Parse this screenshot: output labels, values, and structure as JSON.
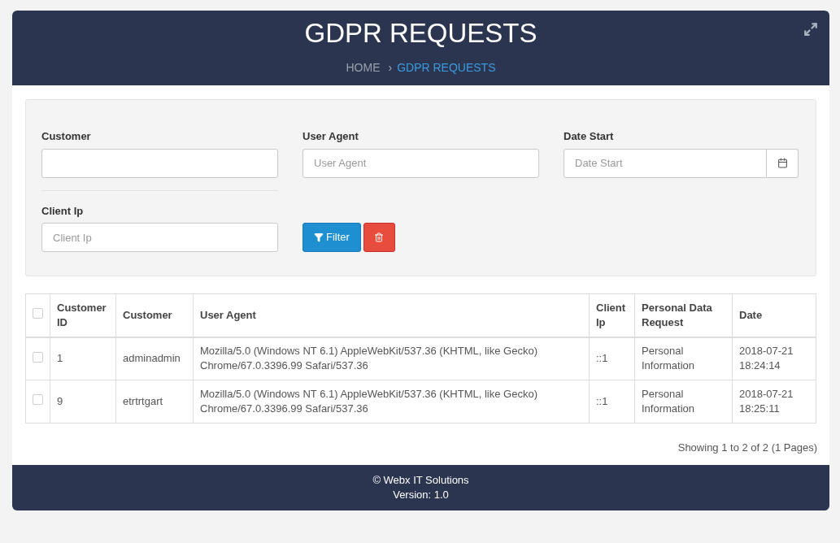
{
  "header": {
    "title": "GDPR REQUESTS",
    "breadcrumb": [
      {
        "label": "HOME",
        "selected": false
      },
      {
        "label": "GDPR REQUESTS",
        "selected": true
      }
    ],
    "separator": "›"
  },
  "filters": {
    "fields": [
      {
        "label": "Customer",
        "kind": "text"
      },
      {
        "label": "User Agent",
        "placeholder": "User Agent",
        "kind": "text"
      },
      {
        "label": "Date Start",
        "placeholder": "Date Start",
        "kind": "date"
      },
      {
        "label": "Client Ip",
        "placeholder": "Client Ip",
        "kind": "text"
      }
    ],
    "filter_button": "Filter"
  },
  "table": {
    "select_all_checked": false,
    "columns": [
      "Customer ID",
      "Customer",
      "User Agent",
      "Client Ip",
      "Personal Data Request",
      "Date"
    ],
    "rows": [
      {
        "checked": false,
        "cells": [
          "1",
          "adminadmin",
          "Mozilla/5.0 (Windows NT 6.1) AppleWebKit/537.36 (KHTML, like Gecko) Chrome/67.0.3396.99 Safari/537.36",
          "::1",
          "Personal Information",
          "2018-07-21 18:24:14"
        ]
      },
      {
        "checked": false,
        "cells": [
          "9",
          "etrtrtgart",
          "Mozilla/5.0 (Windows NT 6.1) AppleWebKit/537.36 (KHTML, like Gecko) Chrome/67.0.3396.99 Safari/537.36",
          "::1",
          "Personal Information",
          "2018-07-21 18:25:11"
        ]
      }
    ]
  },
  "pagination_info": "Showing 1 to 2 of 2 (1 Pages)",
  "footer": {
    "copyright": "© Webx IT Solutions",
    "version": "Version: 1.0"
  }
}
